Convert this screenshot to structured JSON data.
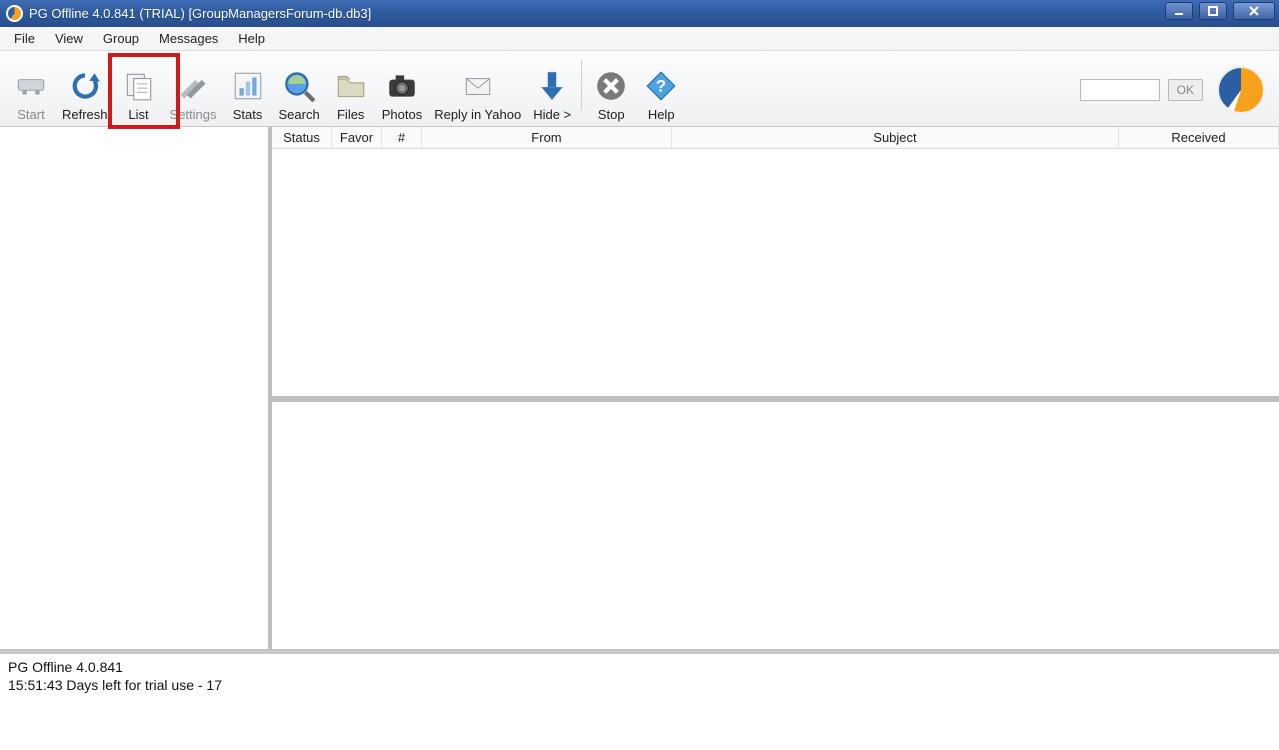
{
  "titlebar": {
    "title": "PG Offline 4.0.841 (TRIAL) [GroupManagersForum-db.db3]"
  },
  "menubar": [
    "File",
    "View",
    "Group",
    "Messages",
    "Help"
  ],
  "toolbar": {
    "items": [
      {
        "name": "start",
        "label": "Start",
        "disabled": true
      },
      {
        "name": "refresh",
        "label": "Refresh"
      },
      {
        "name": "list",
        "label": "List"
      },
      {
        "name": "settings",
        "label": "Settings",
        "disabled": true
      },
      {
        "name": "stats",
        "label": "Stats"
      },
      {
        "name": "search",
        "label": "Search"
      },
      {
        "name": "files",
        "label": "Files"
      },
      {
        "name": "photos",
        "label": "Photos"
      },
      {
        "name": "reply",
        "label": "Reply in Yahoo"
      },
      {
        "name": "hide",
        "label": "Hide >"
      },
      {
        "name": "stop",
        "label": "Stop"
      },
      {
        "name": "help",
        "label": "Help"
      }
    ],
    "ok_label": "OK"
  },
  "columns": {
    "status": "Status",
    "favor": "Favor",
    "num": "#",
    "from": "From",
    "subject": "Subject",
    "received": "Received"
  },
  "status": {
    "line1": "PG Offline 4.0.841",
    "line2": "15:51:43 Days left for trial use - 17"
  }
}
